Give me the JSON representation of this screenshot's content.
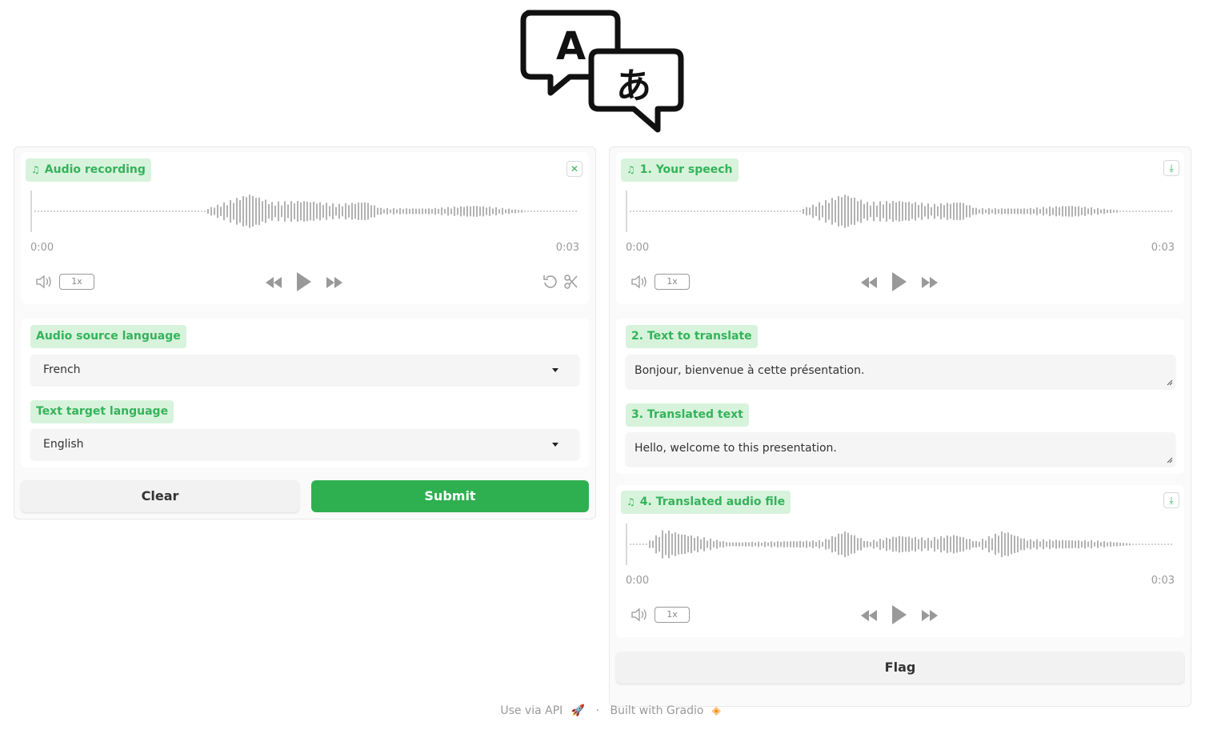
{
  "colors": {
    "accent": "#2fb050",
    "badge_bg": "#d8f3dc",
    "badge_text": "#34b35a"
  },
  "left": {
    "audio": {
      "label": "Audio recording",
      "time_start": "0:00",
      "time_end": "0:03",
      "speed": "1x"
    },
    "source_language": {
      "label": "Audio source language",
      "value": "French"
    },
    "target_language": {
      "label": "Text target language",
      "value": "English"
    },
    "clear_label": "Clear",
    "submit_label": "Submit"
  },
  "right": {
    "speech": {
      "label": "1. Your speech",
      "time_start": "0:00",
      "time_end": "0:03",
      "speed": "1x"
    },
    "text_to_translate": {
      "label": "2. Text to translate",
      "value": "Bonjour, bienvenue à cette présentation."
    },
    "translated_text": {
      "label": "3. Translated text",
      "value": "Hello, welcome to this presentation."
    },
    "translated_audio": {
      "label": "4. Translated audio file",
      "time_start": "0:00",
      "time_end": "0:03",
      "speed": "1x"
    },
    "flag_label": "Flag"
  },
  "footer": {
    "api": "Use via API",
    "sep": "·",
    "built": "Built with Gradio"
  },
  "icons": [
    "translate-logo-icon",
    "music-note-icon",
    "close-icon",
    "download-icon",
    "volume-icon",
    "rewind-icon",
    "play-icon",
    "fast-forward-icon",
    "undo-icon",
    "scissors-icon",
    "rocket-icon",
    "gradio-logo-icon"
  ]
}
